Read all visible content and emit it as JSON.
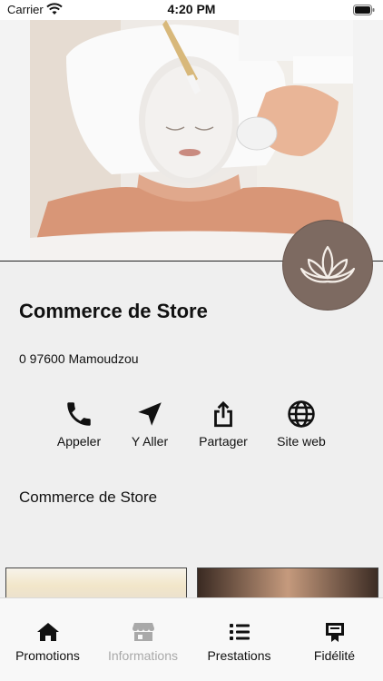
{
  "status_bar": {
    "carrier": "Carrier",
    "time": "4:20 PM"
  },
  "store": {
    "name": "Commerce de Store",
    "address": "0 97600 Mamoudzou"
  },
  "actions": [
    {
      "label": "Appeler",
      "icon": "phone-icon"
    },
    {
      "label": "Y Aller",
      "icon": "navigation-arrow-icon"
    },
    {
      "label": "Partager",
      "icon": "share-icon"
    },
    {
      "label": "Site web",
      "icon": "globe-icon"
    }
  ],
  "section": {
    "title": "Commerce de Store"
  },
  "tabs": [
    {
      "label": "Promotions",
      "icon": "home-icon",
      "active": true
    },
    {
      "label": "Informations",
      "icon": "store-icon",
      "active": false,
      "dimmed": true
    },
    {
      "label": "Prestations",
      "icon": "list-icon",
      "active": false
    },
    {
      "label": "Fidélité",
      "icon": "loyalty-card-icon",
      "active": false
    }
  ],
  "colors": {
    "logo_badge": "#7d6a61",
    "tab_inactive": "#a9a9a9",
    "background": "#efefef"
  }
}
